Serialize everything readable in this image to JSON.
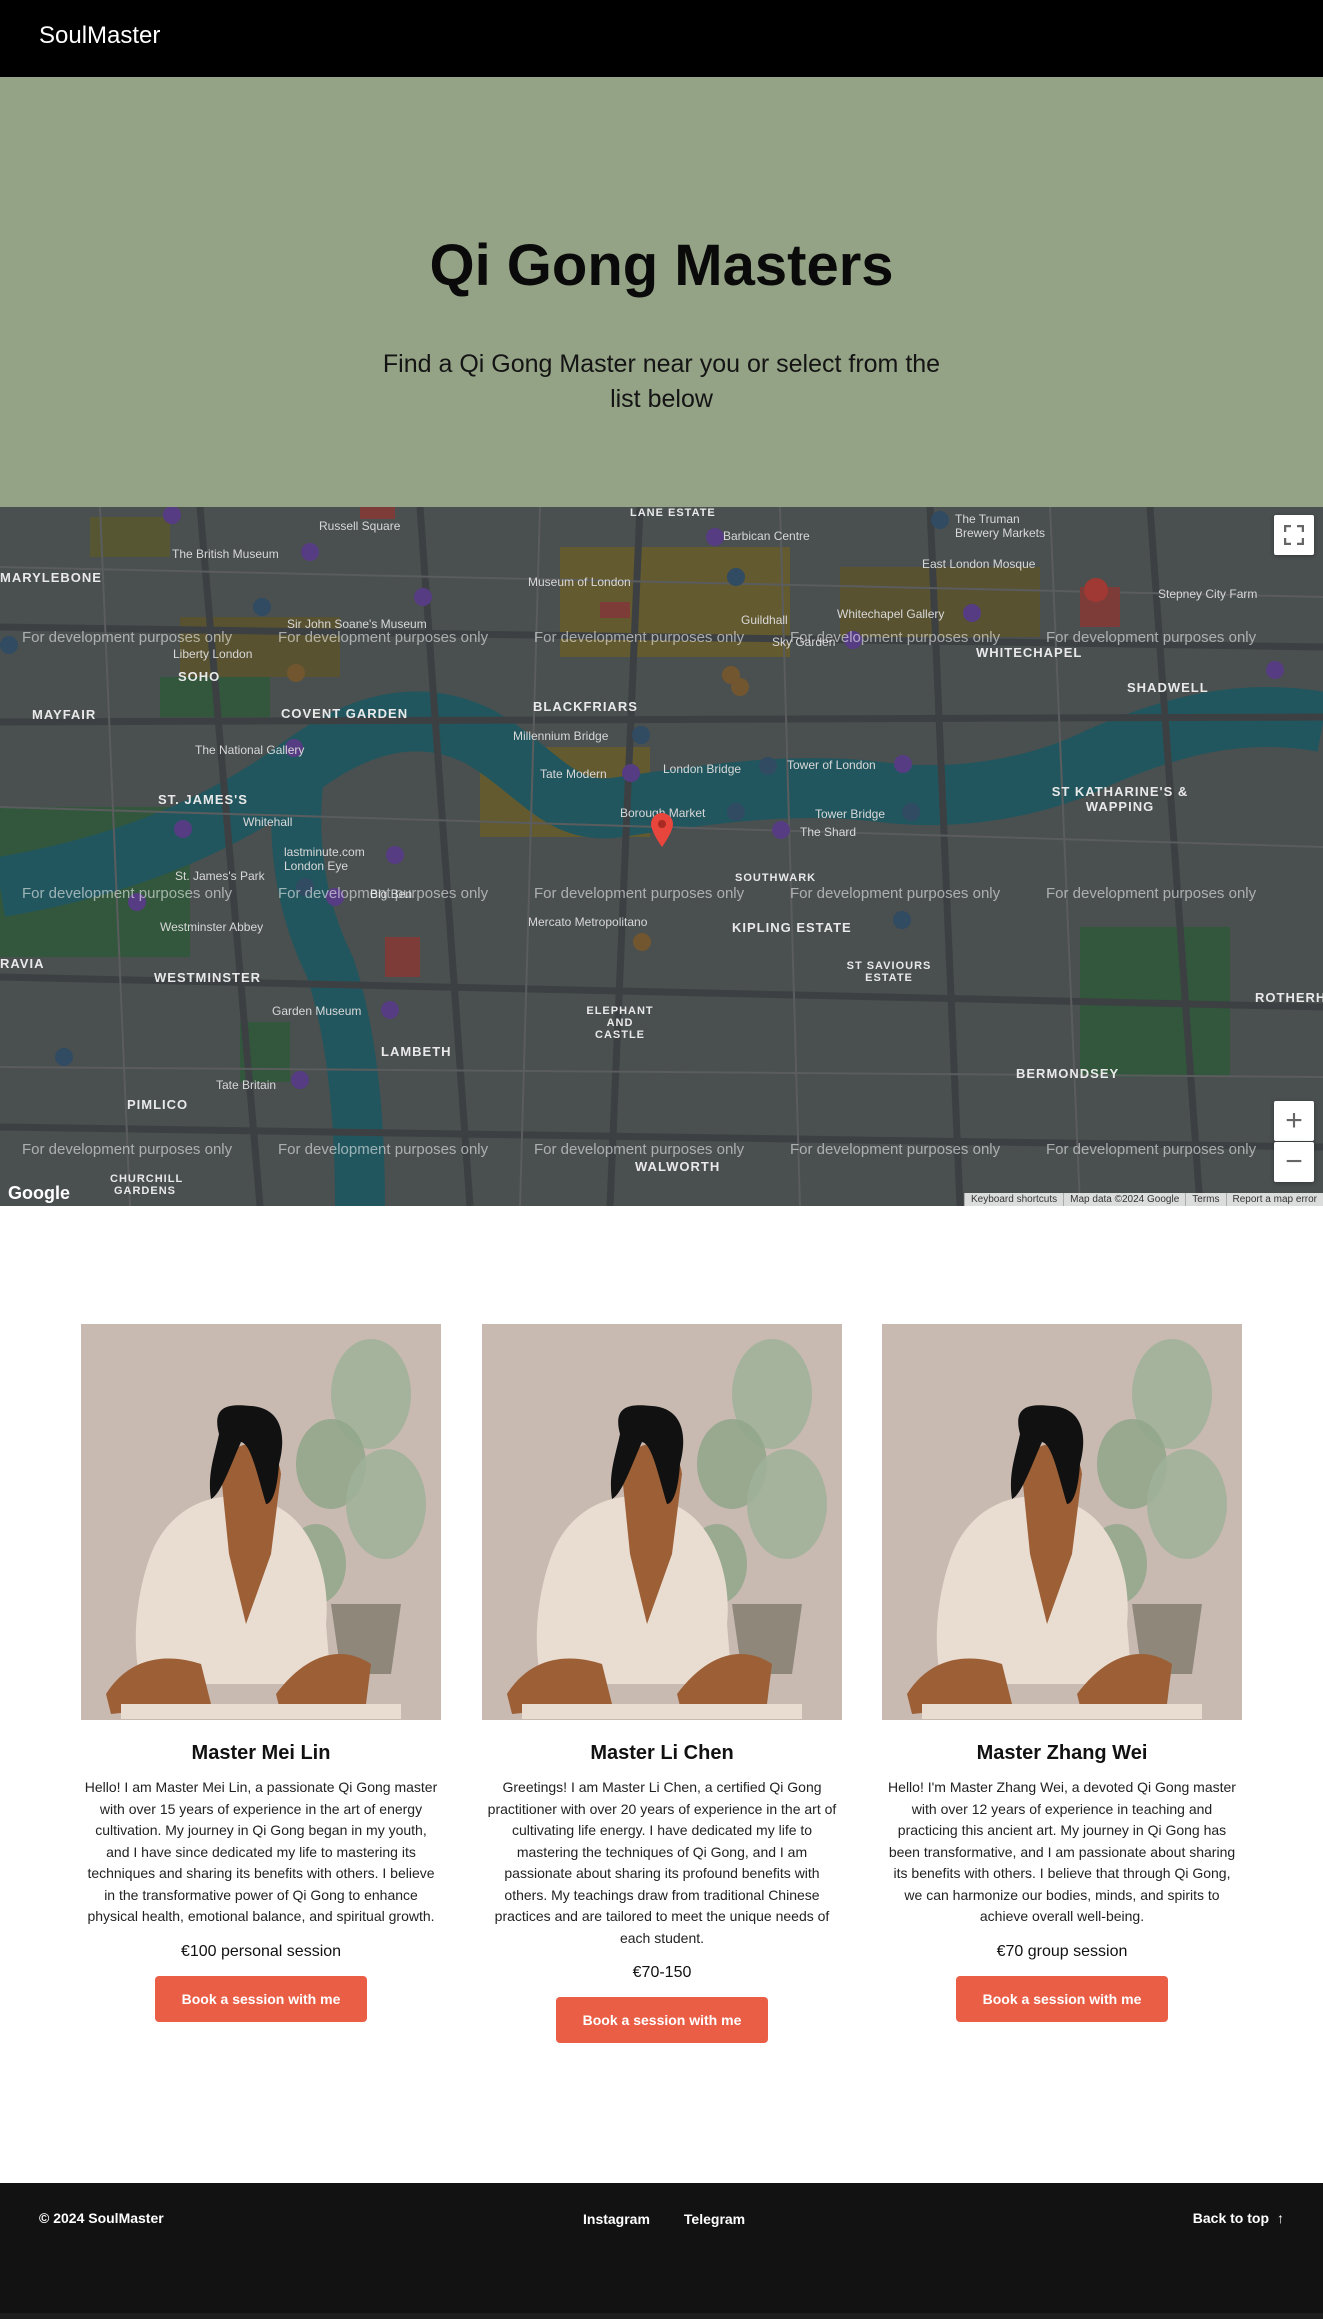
{
  "header": {
    "brand": "SoulMaster"
  },
  "hero": {
    "title": "Qi Gong Masters",
    "subtitle": "Find a Qi Gong Master near you or select from the list below"
  },
  "map": {
    "watermark": "For development purposes only",
    "provider_logo": "Google",
    "footer": [
      "Keyboard shortcuts",
      "Map data ©2024 Google",
      "Terms",
      "Report a map error"
    ],
    "zoom_in": "+",
    "zoom_out": "−",
    "areas": [
      "MARYLEBONE",
      "SOHO",
      "MAYFAIR",
      "COVENT GARDEN",
      "BLACKFRIARS",
      "WHITECHAPEL",
      "SHADWELL",
      "ST. JAMES'S",
      "ST KATHARINE'S & WAPPING",
      "WESTMINSTER",
      "KIPLING ESTATE",
      "ST SAVIOURS ESTATE",
      "ELEPHANT AND CASTLE",
      "LAMBETH",
      "BERMONDSEY",
      "PIMLICO",
      "WALWORTH",
      "CHURCHILL GARDENS",
      "ROTHERH",
      "RAVIA",
      "SOUTHWARK",
      "LANE ESTATE"
    ],
    "pois": [
      "Russell Square",
      "The British Museum",
      "Barbican Centre",
      "Museum of London",
      "East London Mosque",
      "Liberty London",
      "Sir John Soane's Museum",
      "Guildhall",
      "Whitechapel Gallery",
      "The National Gallery",
      "Millennium Bridge",
      "Tate Modern",
      "London Bridge",
      "Tower of London",
      "Borough Market",
      "Tower Bridge",
      "The Shard",
      "Whitehall",
      "lastminute.com London Eye",
      "St. James's Park",
      "Westminster Abbey",
      "Mercato Metropolitano",
      "Garden Museum",
      "Tate Britain",
      "Big Ben",
      "Sky Garden",
      "Stepney City Farm",
      "The Truman Brewery Markets"
    ]
  },
  "masters": [
    {
      "name": "Master Mei Lin",
      "bio": "Hello! I am Master Mei Lin, a passionate Qi Gong master with over 15 years of experience in the art of energy cultivation. My journey in Qi Gong began in my youth, and I have since dedicated my life to mastering its techniques and sharing its benefits with others. I believe in the transformative power of Qi Gong to enhance physical health, emotional balance, and spiritual growth.",
      "price": "€100 personal session",
      "cta": "Book a session with me"
    },
    {
      "name": "Master Li Chen",
      "bio": "Greetings! I am Master Li Chen, a certified Qi Gong practitioner with over 20 years of experience in the art of cultivating life energy. I have dedicated my life to mastering the techniques of Qi Gong, and I am passionate about sharing its profound benefits with others. My teachings draw from traditional Chinese practices and are tailored to meet the unique needs of each student.",
      "price": "€70-150",
      "cta": "Book a session with me"
    },
    {
      "name": "Master Zhang Wei",
      "bio": "Hello! I'm Master Zhang Wei, a devoted Qi Gong master with over 12 years of experience in teaching and practicing this ancient art. My journey in Qi Gong has been transformative, and I am passionate about sharing its benefits with others. I believe that through Qi Gong, we can harmonize our bodies, minds, and spirits to achieve overall well-being.",
      "price": "€70 group session",
      "cta": "Book a session with me"
    }
  ],
  "footer": {
    "copyright": "© 2024 SoulMaster",
    "links": [
      "Instagram",
      "Telegram"
    ],
    "back_to_top": "Back to top",
    "back_icon": "↑"
  },
  "colors": {
    "hero_bg": "#94a386",
    "accent": "#ea5e46",
    "footer_bg": "#121212"
  }
}
